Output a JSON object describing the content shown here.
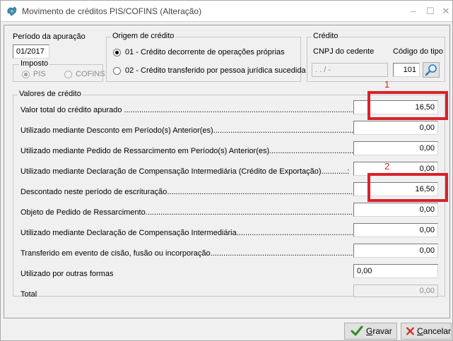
{
  "window": {
    "title": "Movimento de créditos PIS/COFINS (Alteração)",
    "minimize_glyph": "–",
    "maximize_glyph": "☐",
    "close_glyph": "✕"
  },
  "periodo": {
    "label": "Período da apuração",
    "value": "01/2017"
  },
  "imposto": {
    "title": "Imposto",
    "options": [
      "PIS",
      "COFINS"
    ],
    "selected": "PIS"
  },
  "origem": {
    "title": "Origem de crédito",
    "options": [
      "01 - Crédito decorrente de operações próprias",
      "02 - Crédito transferido por pessoa jurídica sucedida"
    ],
    "selected_index": 0
  },
  "credito": {
    "title": "Crédito",
    "cnpj_label": "CNPJ do cedente",
    "cnpj_value": " .   .   /    -",
    "codigo_label": "Código do tipo",
    "codigo_value": "101"
  },
  "valores": {
    "title": "Valores de crédito",
    "rows": [
      {
        "label": "Valor total do crédito apurado ",
        "dots": ".......................................................................................................................:",
        "value": "16,50"
      },
      {
        "label": "Utilizado mediante Desconto em Período(s) Anterior(es)",
        "dots": ".......................................................................................:",
        "value": "0,00"
      },
      {
        "label": "Utilizado mediante Pedido de Ressarcimento em  Período(s) Anterior(es)",
        "dots": "...................................................:",
        "value": "0,00"
      },
      {
        "label": "Utilizado mediante Declaração de Compensação Intermediária (Crédito de Exportação)",
        "dots": "............:",
        "value": "0,00"
      },
      {
        "label": "Descontado neste período de escrituração",
        "dots": "........................................................................................................:",
        "value": "16,50"
      },
      {
        "label": "Objeto de Pedido de Ressarcimento",
        "dots": ".....................................................................................................................:",
        "value": "0,00"
      },
      {
        "label": "Utilizado mediante Declaração de Compensação Intermediária",
        "dots": "...........................................................................:",
        "value": "0,00"
      },
      {
        "label": "Transferido em evento de cisão, fusão ou incorporação",
        "dots": "....................................................................................:",
        "value": "0,00"
      },
      {
        "label": "Utilizado por outras formas",
        "dots": "",
        "value": "0,00"
      },
      {
        "label": "Total",
        "dots": "",
        "value": "0,00"
      }
    ]
  },
  "annotations": {
    "first": "1",
    "second": "2",
    "color": "#d9212b"
  },
  "buttons": {
    "gravar_mnemonic": "G",
    "gravar_rest": "ravar",
    "cancelar_mnemonic": "C",
    "cancelar_rest": "ancelar"
  }
}
